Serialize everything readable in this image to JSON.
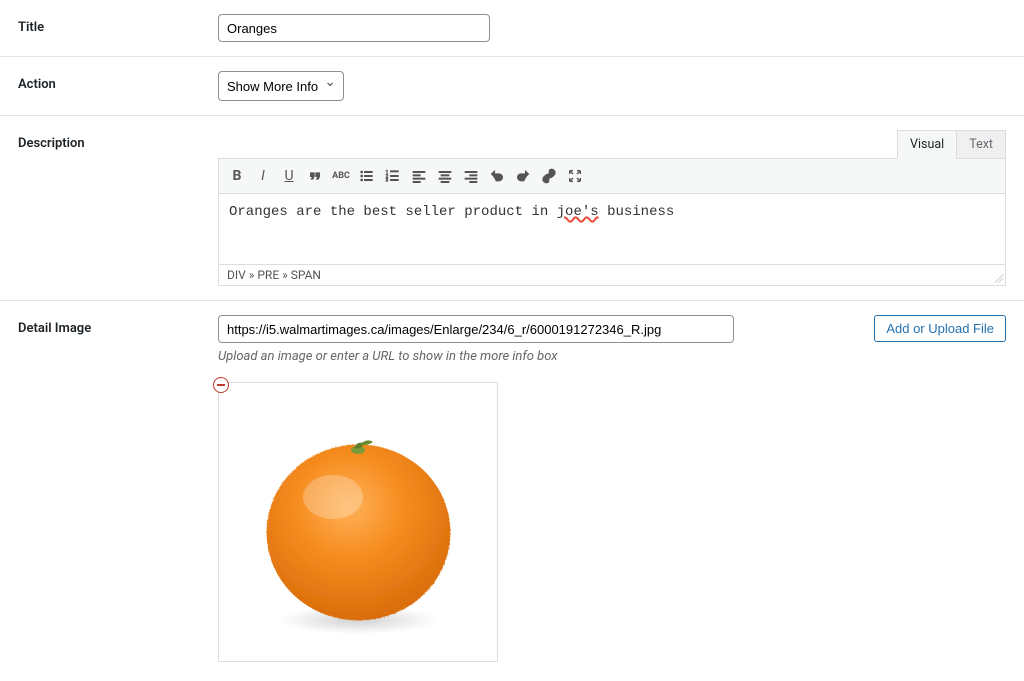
{
  "labels": {
    "title": "Title",
    "action": "Action",
    "description": "Description",
    "detail_image": "Detail Image"
  },
  "title": {
    "value": "Oranges"
  },
  "action": {
    "selected": "Show More Info"
  },
  "editor": {
    "tabs": {
      "visual": "Visual",
      "text": "Text"
    },
    "content_pre": "Oranges are the best seller product in ",
    "content_err": "joe's",
    "content_post": " business",
    "path": "DIV » PRE » SPAN"
  },
  "detail_image": {
    "url": "https://i5.walmartimages.ca/images/Enlarge/234/6_r/6000191272346_R.jpg",
    "hint": "Upload an image or enter a URL to show in the more info box",
    "upload_button": "Add or Upload File"
  }
}
